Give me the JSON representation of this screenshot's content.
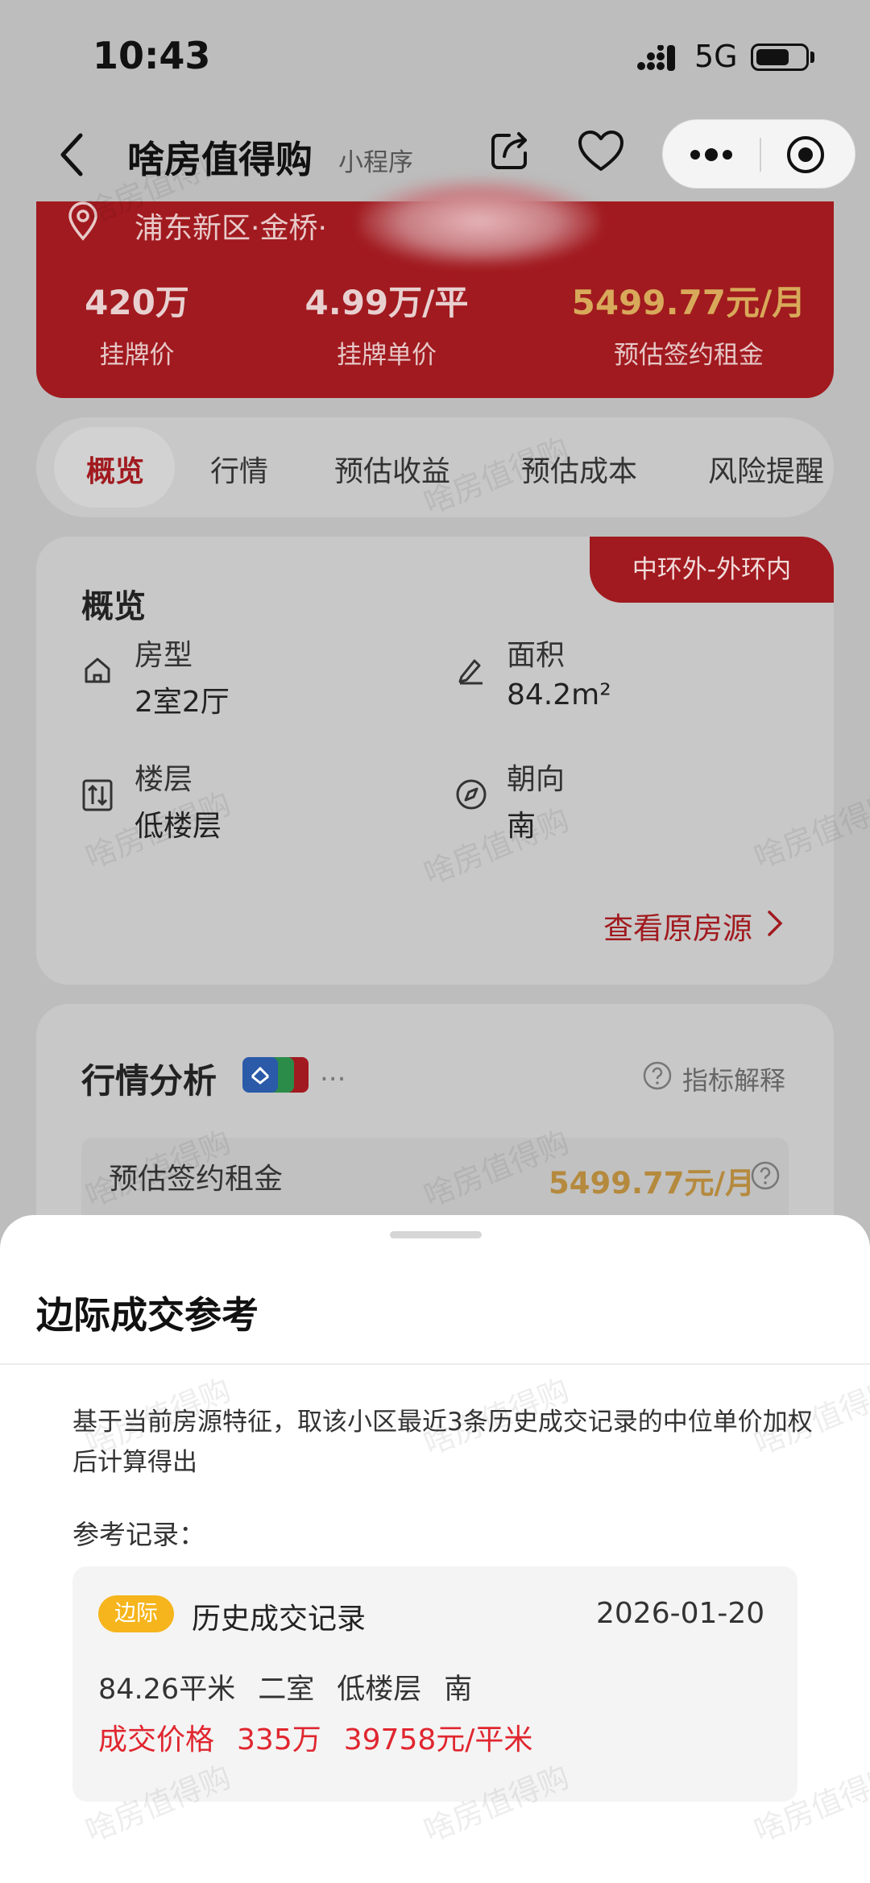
{
  "status_bar": {
    "time": "10:43",
    "network": "5G"
  },
  "nav": {
    "title": "啥房值得购",
    "subtitle": "小程序"
  },
  "header": {
    "location": "浦东新区·金桥·",
    "stats": [
      {
        "value": "420万",
        "label": "挂牌价"
      },
      {
        "value": "4.99万/平",
        "label": "挂牌单价"
      },
      {
        "value": "5499.77元/月",
        "label": "预估签约租金"
      }
    ]
  },
  "tabs": [
    "概览",
    "行情",
    "预估收益",
    "预估成本",
    "风险提醒"
  ],
  "overview": {
    "badge": "中环外-外环内",
    "title": "概览",
    "items": [
      {
        "label": "房型",
        "value": "2室2厅",
        "icon": "house-icon"
      },
      {
        "label": "面积",
        "value": "84.2m²",
        "icon": "edit-icon"
      },
      {
        "label": "楼层",
        "value": "低楼层",
        "icon": "floor-icon"
      },
      {
        "label": "朝向",
        "value": "南",
        "icon": "compass-icon"
      }
    ],
    "link": "查看原房源"
  },
  "market": {
    "title": "行情分析",
    "explain": "指标解释",
    "ellipsis": "...",
    "row_label": "预估签约租金",
    "row_value": "5499.77元/月"
  },
  "sheet": {
    "title": "边际成交参考",
    "description": "基于当前房源特征，取该小区最近3条历史成交记录的中位单价加权后计算得出",
    "ref_label": "参考记录：",
    "record": {
      "badge": "边际",
      "name": "历史成交记录",
      "date": "2026-01-20",
      "attrs": [
        "84.26平米",
        "二室",
        "低楼层",
        "南"
      ],
      "price_label": "成交价格",
      "price": "335万",
      "unit_price": "39758元/平米"
    }
  },
  "watermark": "啥房值得购",
  "colors": {
    "brand_red": "#a11a1f",
    "gold": "#d8a95a",
    "badge_yellow": "#f6b51c",
    "price_red": "#e0262f"
  }
}
